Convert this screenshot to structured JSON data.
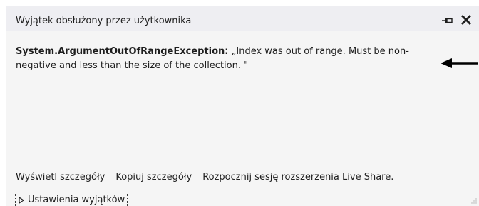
{
  "window": {
    "title": "Wyjątek obsłużony przez użytkownika",
    "pin_icon": "pin-icon",
    "close_icon": "close-icon"
  },
  "exception": {
    "type": "System.ArgumentOutOfRangeException:",
    "message": " „Index was out of range. Must be non-negative and less than the size of the collection. \""
  },
  "actions": {
    "view_details": "Wyświetl szczegóły",
    "copy_details": "Kopiuj szczegóły",
    "live_share": "Rozpocznij sesję rozszerzenia Live Share."
  },
  "settings": {
    "label": "Ustawienia wyjątków",
    "expander_icon": "triangle-right-icon"
  },
  "colors": {
    "panel_bg": "#f5f5f5",
    "titlebar_bg": "#eeeef2",
    "text": "#1e1e1e"
  }
}
